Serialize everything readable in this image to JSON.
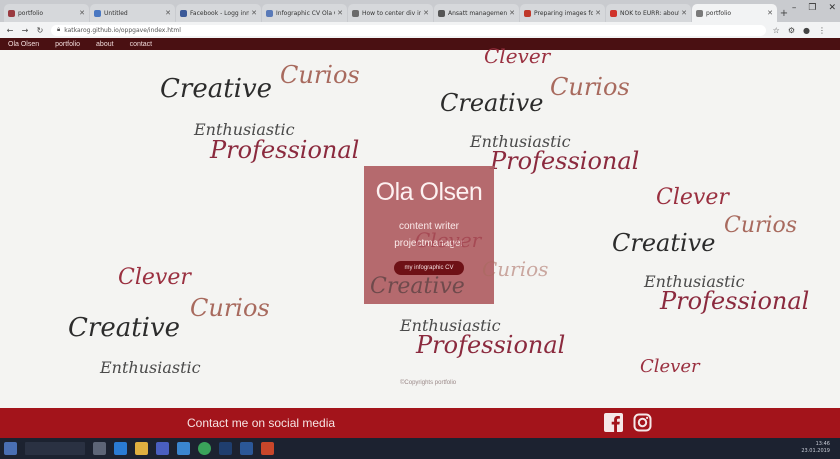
{
  "browser": {
    "tabs": [
      {
        "label": "portfolio",
        "favicon_color": "#9a3a40",
        "active": false
      },
      {
        "label": "Untitled",
        "favicon_color": "#4a78c2",
        "active": false
      },
      {
        "label": "Facebook - Logg inn eller",
        "favicon_color": "#3b5998",
        "active": false
      },
      {
        "label": "Infographic CV Ola Olsen",
        "favicon_color": "#5a7ab8",
        "active": false
      },
      {
        "label": "How to center div in",
        "favicon_color": "#6a6a6a",
        "active": false
      },
      {
        "label": "Ansatt management",
        "favicon_color": "#555",
        "active": false
      },
      {
        "label": "Preparing images for",
        "favicon_color": "#c0392b",
        "active": false
      },
      {
        "label": "NOK to EURR: about",
        "favicon_color": "#d0342c",
        "active": false
      },
      {
        "label": "portfolio",
        "favicon_color": "#7a7a7a",
        "active": true
      }
    ],
    "new_tab_glyph": "+",
    "window_controls": [
      "–",
      "❐",
      "✕"
    ],
    "url": "katkarog.github.io/oppgave/index.html"
  },
  "site": {
    "nav": [
      "Ola Olsen",
      "portfolio",
      "about",
      "contact"
    ],
    "words": {
      "creative": "Creative",
      "curios": "Curios",
      "enthusiastic": "Enthusiastic",
      "professional": "Professional",
      "clever": "Clever"
    },
    "hero": {
      "name": "Ola Olsen",
      "role1": "content writer",
      "role2": "projectmanager",
      "button": "my infographic CV"
    },
    "copyright": "©Copyrights portfolio",
    "footer_text": "Contact me on social media",
    "colors": {
      "nav_bg": "#4a1012",
      "hero_bg": "#af5f64",
      "button_bg": "#6e1116",
      "footer_bg": "#a3141b"
    }
  },
  "taskbar": {
    "apps": [
      "windows-icon",
      "search-box",
      "task-view-icon",
      "edge-icon",
      "explorer-icon",
      "store-icon",
      "mail-icon",
      "chrome-icon",
      "photoshop-icon",
      "word-icon",
      "powerpoint-icon"
    ],
    "clock": "13:46",
    "date": "23.01.2019"
  }
}
